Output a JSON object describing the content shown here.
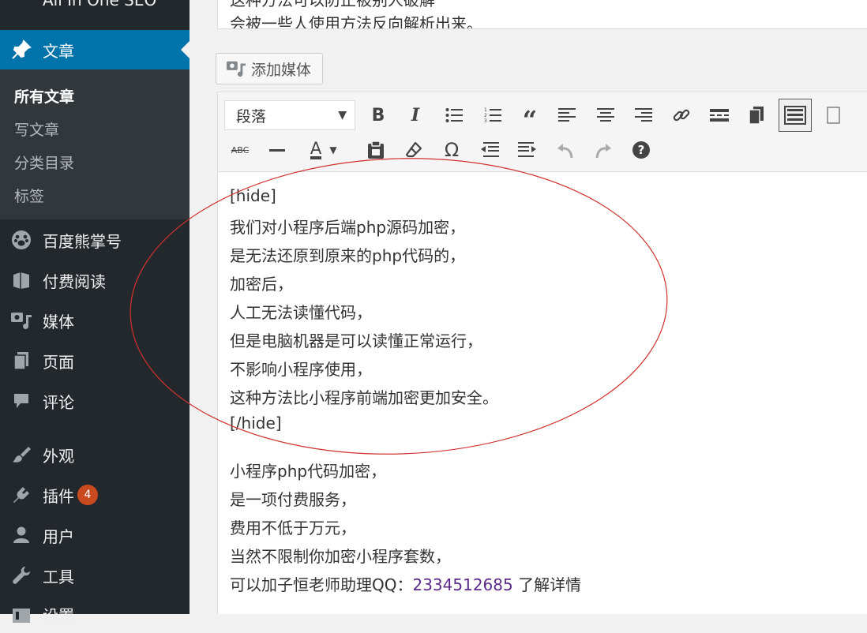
{
  "sidebar": {
    "partial_top_item": "All In One SEO",
    "active": {
      "label": "文章",
      "icon": "pin-icon"
    },
    "submenu": [
      "所有文章",
      "写文章",
      "分类目录",
      "标签"
    ],
    "items": [
      {
        "label": "百度熊掌号",
        "icon": "paw-icon"
      },
      {
        "label": "付费阅读",
        "icon": "book-icon"
      },
      {
        "label": "媒体",
        "icon": "media-icon"
      },
      {
        "label": "页面",
        "icon": "page-icon"
      },
      {
        "label": "评论",
        "icon": "comment-icon"
      },
      {
        "label": "外观",
        "icon": "brush-icon"
      },
      {
        "label": "插件",
        "icon": "plugin-icon",
        "badge": "4"
      },
      {
        "label": "用户",
        "icon": "user-icon"
      },
      {
        "label": "工具",
        "icon": "wrench-icon"
      },
      {
        "label": "设置",
        "icon": "settings-icon"
      }
    ]
  },
  "top_editor_lines": [
    "这种方法可以防止被别人破解",
    "会被一些人使用方法反向解析出来。"
  ],
  "add_media_label": "添加媒体",
  "toolbar": {
    "format_value": "段落"
  },
  "content": {
    "lines": [
      "[hide]",
      "我们对小程序后端php源码加密，",
      "是无法还原到原来的php代码的，",
      "加密后，",
      "人工无法读懂代码，",
      "但是电脑机器是可以读懂正常运行，",
      "不影响小程序使用，",
      "这种方法比小程序前端加密更加安全。",
      "[/hide]",
      "小程序php代码加密，",
      "是一项付费服务，",
      "费用不低于万元，",
      "当然不限制你加密小程序套数，"
    ],
    "last_line_prefix": "可以加子恒老师助理QQ：",
    "qq_number": "2334512685",
    "last_line_suffix": " 了解详情"
  },
  "colors": {
    "sidebar_bg": "#23282d",
    "active_bg": "#0073aa",
    "badge": "#ca4a1f",
    "annotation": "#d0312d",
    "link": "#5c2a8a"
  }
}
